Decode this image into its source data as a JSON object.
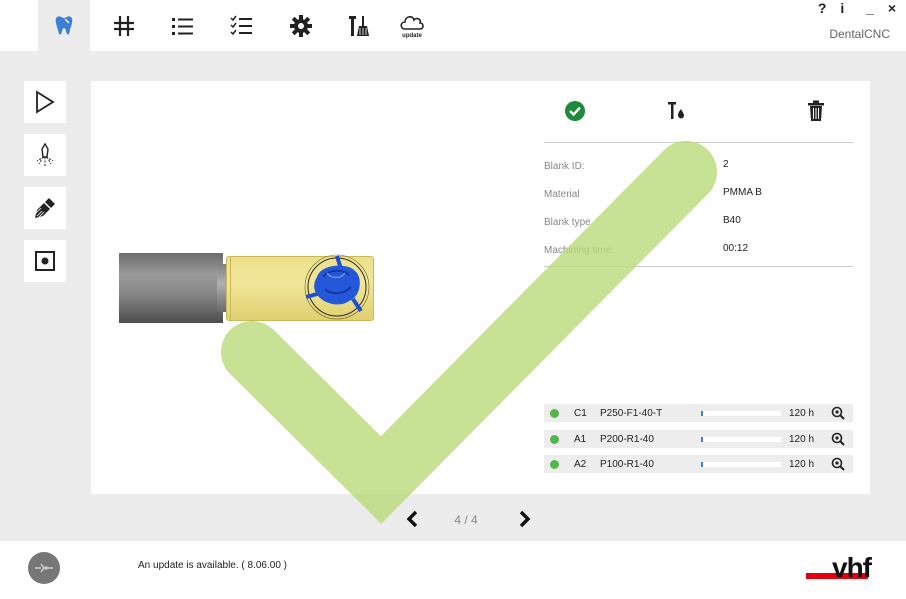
{
  "app": {
    "name": "DentalCNC",
    "window_controls": {
      "help": "?",
      "info": "i",
      "minimize": "_",
      "close": "×"
    }
  },
  "toolbar": {
    "items": [
      {
        "icon": "tooth-icon",
        "active": true
      },
      {
        "icon": "crosshair-icon"
      },
      {
        "icon": "list-icon"
      },
      {
        "icon": "checklist-icon"
      },
      {
        "icon": "gear-icon"
      },
      {
        "icon": "tools-icon"
      },
      {
        "icon": "cloud-update-icon",
        "label": "update"
      }
    ]
  },
  "sidebar": [
    {
      "icon": "play-icon"
    },
    {
      "icon": "spray-icon"
    },
    {
      "icon": "brush-icon"
    },
    {
      "icon": "target-square-icon"
    }
  ],
  "blank": {
    "rows": [
      {
        "label": "Blank ID:",
        "value": "2"
      },
      {
        "label": "Material",
        "value": "PMMA B"
      },
      {
        "label": "Blank type",
        "value": "B40"
      },
      {
        "label": "Machining time:",
        "value": "00:12"
      }
    ]
  },
  "tools": [
    {
      "position": "C1",
      "name": "P250-F1-40-T",
      "life": "120 h",
      "progress": 0.02
    },
    {
      "position": "A1",
      "name": "P200-R1-40",
      "life": "120 h",
      "progress": 0.02
    },
    {
      "position": "A2",
      "name": "P100-R1-40",
      "life": "120 h",
      "progress": 0.02
    }
  ],
  "pager": {
    "text": "4 / 4"
  },
  "footer": {
    "update_message": "An update is available.   ( 8.06.00 )"
  },
  "logo": {
    "text": "vhf"
  },
  "colors": {
    "accent": "#3b7fd6",
    "ok_green": "#4fb848",
    "overlay_check": "#b9d97a",
    "holder_yellow": "#efe38f",
    "logo_red": "#e3000f"
  }
}
